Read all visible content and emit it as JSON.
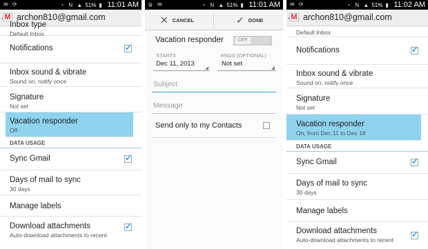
{
  "screens": {
    "left": {
      "status_time": "11:01 AM",
      "battery": "51%",
      "account": "archon810@gmail.com",
      "items": [
        {
          "title": "Inbox type",
          "sub": "Default Inbox"
        },
        {
          "title": "Notifications"
        },
        {
          "title": "Inbox sound & vibrate",
          "sub": "Sound on, notify once"
        },
        {
          "title": "Signature",
          "sub": "Not set"
        },
        {
          "title": "Vacation responder",
          "sub": "Off"
        },
        {
          "section": "DATA USAGE"
        },
        {
          "title": "Sync Gmail"
        },
        {
          "title": "Days of mail to sync",
          "sub": "30 days"
        },
        {
          "title": "Manage labels"
        },
        {
          "title": "Download attachments",
          "sub": "Auto-download attachments to recent"
        }
      ]
    },
    "middle": {
      "status_time": "11:01 AM",
      "battery": "51%",
      "cancel_label": "CANCEL",
      "done_label": "DONE",
      "vacation_label": "Vacation responder",
      "toggle_off": "OFF",
      "starts_label": "STARTS",
      "starts_value": "Dec 11, 2013",
      "ends_label": "ENDS (OPTIONAL)",
      "ends_value": "Not set",
      "subject_placeholder": "Subject",
      "message_placeholder": "Message",
      "contacts_label": "Send only to my Contacts"
    },
    "right": {
      "status_time": "11:02 AM",
      "battery": "51%",
      "account": "archon810@gmail.com",
      "items": [
        {
          "sub": "Default Inbox"
        },
        {
          "title": "Notifications"
        },
        {
          "title": "Inbox sound & vibrate",
          "sub": "Sound on, notify once"
        },
        {
          "title": "Signature",
          "sub": "Not set"
        },
        {
          "title": "Vacation responder",
          "sub": "On, from Dec 11 to Dec 18"
        },
        {
          "section": "DATA USAGE"
        },
        {
          "title": "Sync Gmail"
        },
        {
          "title": "Days of mail to sync",
          "sub": "30 days"
        },
        {
          "title": "Manage labels"
        },
        {
          "title": "Download attachments",
          "sub": "Auto-download attachments to recent"
        }
      ]
    }
  },
  "colors": {
    "highlight": "#8fd3ef",
    "accent": "#2d9fd8",
    "statusbar": "#000000"
  }
}
